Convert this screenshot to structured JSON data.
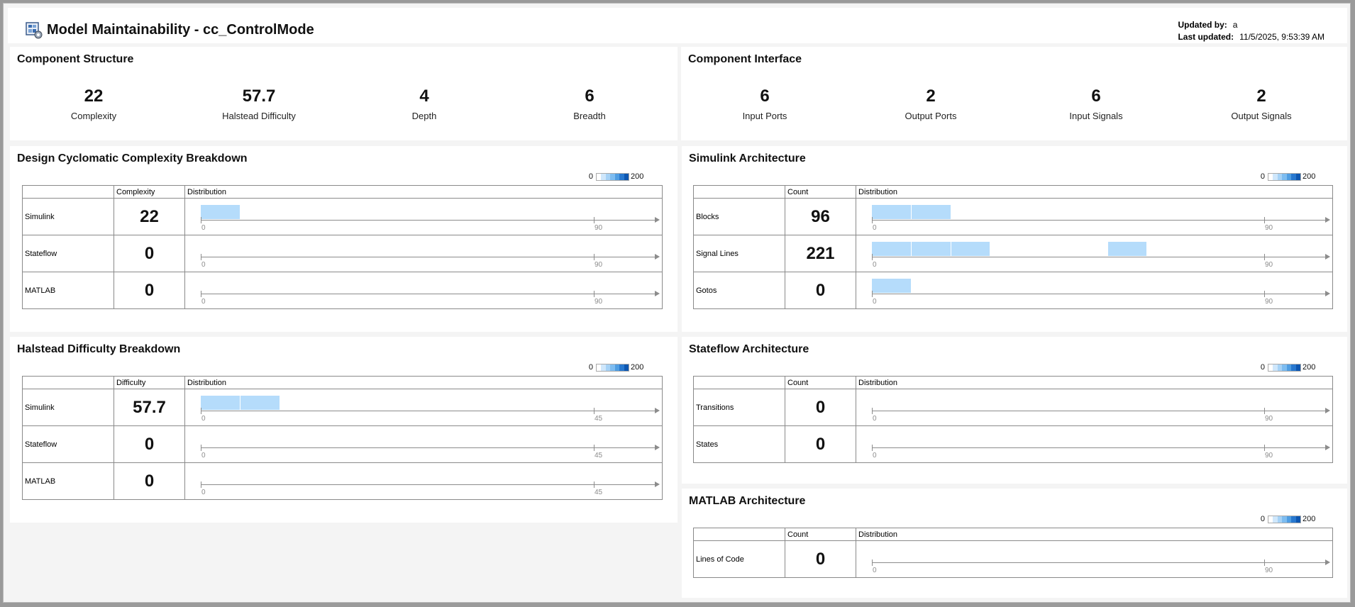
{
  "header": {
    "title": "Model Maintainability - cc_ControlMode",
    "updated_by_label": "Updated by:",
    "updated_by_value": "a",
    "last_updated_label": "Last updated:",
    "last_updated_value": "11/5/2025, 9:53:39 AM"
  },
  "legend": {
    "low": "0",
    "high": "200",
    "colors": [
      "#ffffff",
      "#cfe7fb",
      "#a6d2f6",
      "#7dbcf0",
      "#4f9de2",
      "#2878cf",
      "#0d56b0"
    ]
  },
  "component_structure": {
    "title": "Component Structure",
    "metrics": [
      {
        "value": "22",
        "label": "Complexity"
      },
      {
        "value": "57.7",
        "label": "Halstead Difficulty"
      },
      {
        "value": "4",
        "label": "Depth"
      },
      {
        "value": "6",
        "label": "Breadth"
      }
    ]
  },
  "component_interface": {
    "title": "Component Interface",
    "metrics": [
      {
        "value": "6",
        "label": "Input Ports"
      },
      {
        "value": "2",
        "label": "Output Ports"
      },
      {
        "value": "6",
        "label": "Input Signals"
      },
      {
        "value": "2",
        "label": "Output Signals"
      }
    ]
  },
  "complexity_breakdown": {
    "title": "Design Cyclomatic Complexity Breakdown",
    "value_header": "Complexity",
    "dist_header": "Distribution",
    "axis_min": "0",
    "axis_max": "90",
    "bins": 10,
    "rows": [
      {
        "label": "Simulink",
        "value": "22",
        "bins": [
          1
        ]
      },
      {
        "label": "Stateflow",
        "value": "0",
        "bins": []
      },
      {
        "label": "MATLAB",
        "value": "0",
        "bins": []
      }
    ]
  },
  "halstead_breakdown": {
    "title": "Halstead Difficulty Breakdown",
    "value_header": "Difficulty",
    "dist_header": "Distribution",
    "axis_min": "0",
    "axis_max": "45",
    "bins": 10,
    "rows": [
      {
        "label": "Simulink",
        "value": "57.7",
        "bins": [
          1,
          2
        ]
      },
      {
        "label": "Stateflow",
        "value": "0",
        "bins": []
      },
      {
        "label": "MATLAB",
        "value": "0",
        "bins": []
      }
    ]
  },
  "simulink_architecture": {
    "title": "Simulink Architecture",
    "value_header": "Count",
    "dist_header": "Distribution",
    "axis_min": "0",
    "axis_max": "90",
    "bins": 10,
    "rows": [
      {
        "label": "Blocks",
        "value": "96",
        "bins": [
          1,
          2
        ]
      },
      {
        "label": "Signal Lines",
        "value": "221",
        "bins": [
          1,
          2,
          3,
          7
        ]
      },
      {
        "label": "Gotos",
        "value": "0",
        "bins": [
          1
        ]
      }
    ]
  },
  "stateflow_architecture": {
    "title": "Stateflow Architecture",
    "value_header": "Count",
    "dist_header": "Distribution",
    "axis_min": "0",
    "axis_max": "90",
    "bins": 10,
    "rows": [
      {
        "label": "Transitions",
        "value": "0",
        "bins": []
      },
      {
        "label": "States",
        "value": "0",
        "bins": []
      }
    ]
  },
  "matlab_architecture": {
    "title": "MATLAB Architecture",
    "value_header": "Count",
    "dist_header": "Distribution",
    "axis_min": "0",
    "axis_max": "90",
    "bins": 10,
    "rows": [
      {
        "label": "Lines of Code",
        "value": "0",
        "bins": []
      }
    ]
  }
}
